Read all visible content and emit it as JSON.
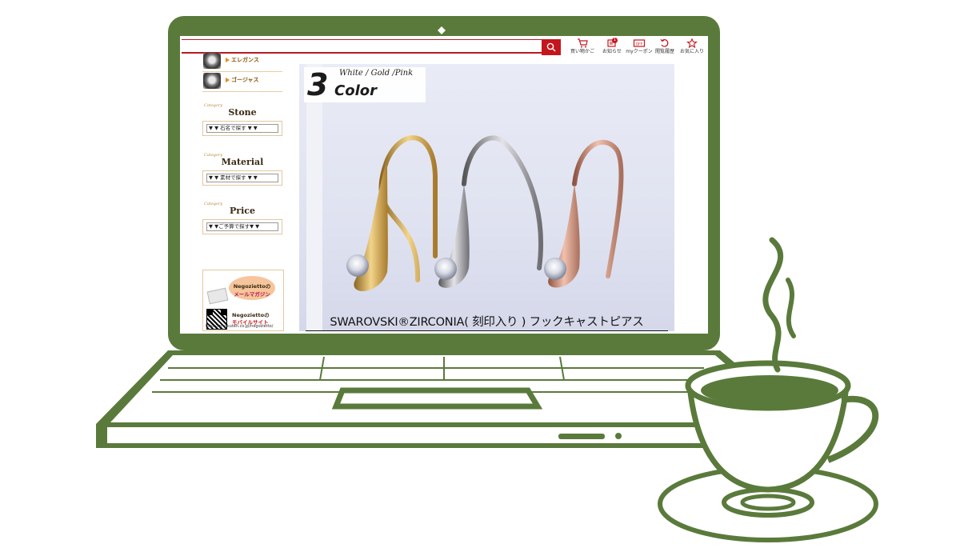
{
  "header": {
    "search_placeholder": "",
    "links": [
      {
        "label": "買い物かご",
        "icon": "cart-icon"
      },
      {
        "label": "お知らせ",
        "icon": "notice-icon",
        "badge": "1"
      },
      {
        "label": "myクーポン",
        "icon": "coupon-icon",
        "icon_text": "OFF"
      },
      {
        "label": "閲覧履歴",
        "icon": "history-icon"
      },
      {
        "label": "お気に入り",
        "icon": "star-icon"
      }
    ],
    "accent": "#c4161c"
  },
  "sidebar": {
    "thumb_items": [
      {
        "label": "エレガンス"
      },
      {
        "label": "ゴージャス"
      }
    ],
    "categories": [
      {
        "small": "Category",
        "title": "Stone",
        "select_value": "▼ ▼ 石名で探す ▼ ▼"
      },
      {
        "small": "Category",
        "title": "Material",
        "select_value": "▼ ▼ 素材で探す ▼ ▼"
      },
      {
        "small": "Category",
        "title": "Price",
        "select_value": "▼ ▼ご予算で探す▼ ▼"
      }
    ],
    "mail": {
      "name": "Negozietto",
      "name_suffix": "の",
      "label": "メールマガジン"
    },
    "mobile": {
      "name": "Negozietto",
      "name_suffix": "の",
      "label": "モバイルサイト",
      "url": "http://m.rakuten.co.jp/negozietto/"
    }
  },
  "banner": {
    "count": "3",
    "count_word": "Color",
    "variants": "White / Gold /Pink",
    "caption": "SWAROVSKI®ZIRCONIA( 刻印入り ) フックキャストピアス"
  },
  "colors": {
    "laptop_green": "#5a7a3b",
    "gold": "#c9a14a",
    "silver": "#9a9a9e",
    "pink_gold": "#c98e7b"
  }
}
